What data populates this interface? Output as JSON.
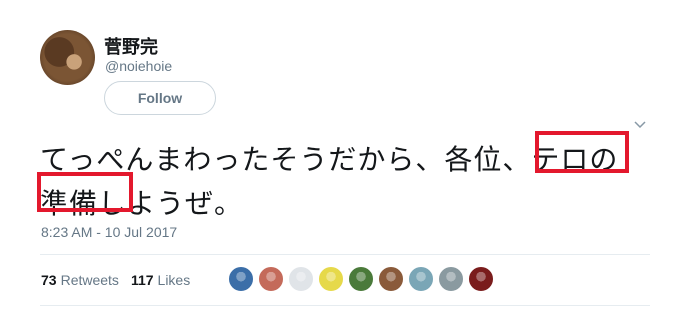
{
  "user": {
    "display_name": "菅野完",
    "handle": "@noiehoie"
  },
  "follow_button": {
    "label": "Follow"
  },
  "tweet": {
    "line1": "てっぺんまわったそうだから、各位、テロの",
    "line2": "準備しようぜ。",
    "timestamp": "8:23 AM - 10 Jul 2017"
  },
  "stats": {
    "retweets_count": "73",
    "retweets_label": "Retweets",
    "likes_count": "117",
    "likes_label": "Likes"
  },
  "liker_avatars": [
    {
      "color": "#3b6ea8"
    },
    {
      "color": "#c46a5a"
    },
    {
      "color": "#e0e4e8"
    },
    {
      "color": "#e6d94a"
    },
    {
      "color": "#4a7a3a"
    },
    {
      "color": "#8a5a3a"
    },
    {
      "color": "#7aa6b6"
    },
    {
      "color": "#8a9aa0"
    },
    {
      "color": "#7a1c1c"
    }
  ],
  "colors": {
    "highlight_box": "#e3182d",
    "muted_text": "#657786"
  }
}
